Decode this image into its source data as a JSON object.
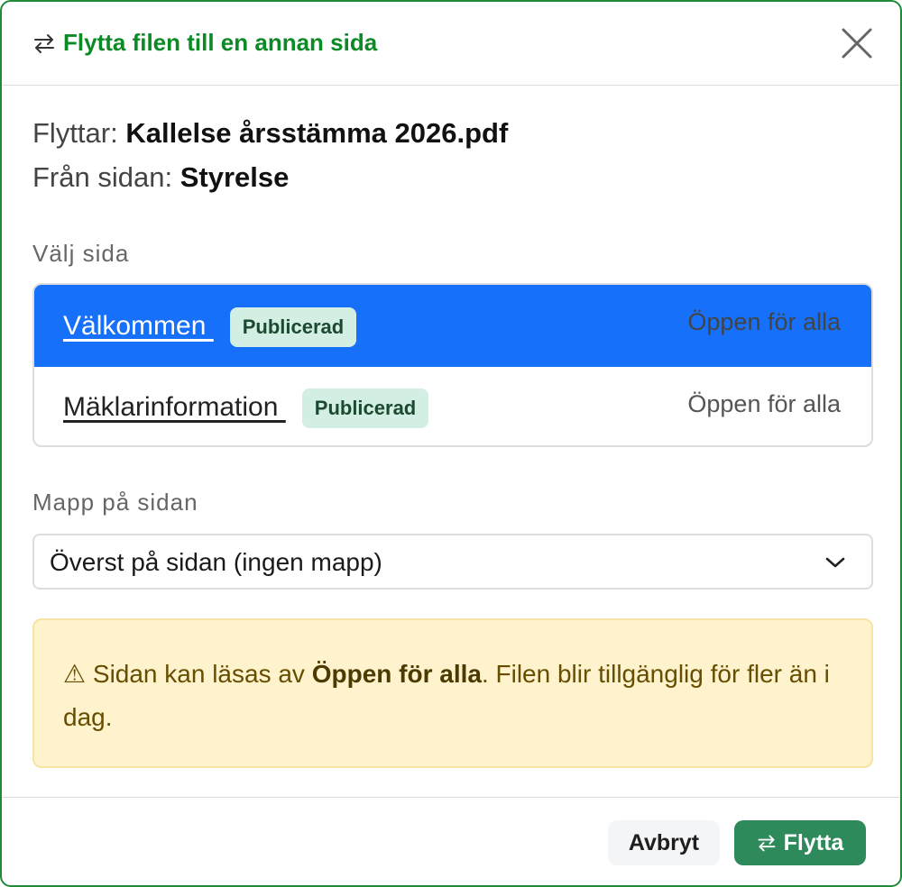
{
  "dialog": {
    "title": "Flytta filen till en annan sida",
    "title_icon": "swap-arrows-icon",
    "close_icon": "close-icon"
  },
  "file_info": {
    "moving_label": "Flyttar:",
    "moving_value": "Kallelse årsstämma 2026.pdf",
    "from_label": "Från sidan:",
    "from_value": "Styrelse"
  },
  "page_select": {
    "label": "Välj sida",
    "pages": [
      {
        "name": "Välkommen ",
        "badge": "Publicerad",
        "access": "Öppen för alla",
        "selected": true
      },
      {
        "name": "Mäklarinformation ",
        "badge": "Publicerad",
        "access": "Öppen för alla",
        "selected": false
      }
    ]
  },
  "folder_select": {
    "label": "Mapp på sidan",
    "value": "Överst på sidan (ingen mapp)"
  },
  "warning": {
    "icon": "⚠",
    "text_before": " Sidan kan läsas av ",
    "text_bold": "Öppen för alla",
    "text_after": ". Filen blir tillgänglig för fler än i dag."
  },
  "footer": {
    "cancel_label": "Avbryt",
    "move_label": "Flytta"
  },
  "colors": {
    "accent_green": "#0c8a26",
    "selected_blue": "#1670fa",
    "badge_bg": "#d3eee3",
    "warning_bg": "#fef3cd",
    "move_button": "#2e8a5a"
  }
}
